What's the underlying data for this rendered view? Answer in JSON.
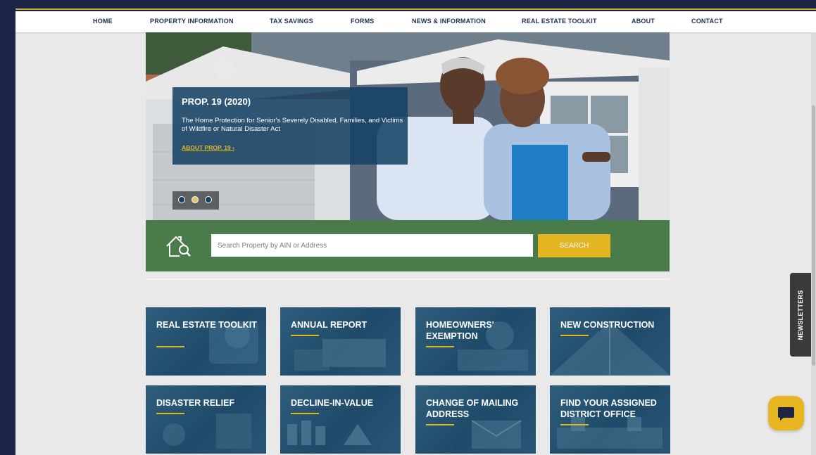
{
  "nav": {
    "items": [
      {
        "label": "HOME"
      },
      {
        "label": "PROPERTY INFORMATION"
      },
      {
        "label": "TAX SAVINGS"
      },
      {
        "label": "FORMS"
      },
      {
        "label": "NEWS & INFORMATION"
      },
      {
        "label": "REAL ESTATE TOOLKIT"
      },
      {
        "label": "ABOUT"
      },
      {
        "label": "CONTACT"
      }
    ]
  },
  "hero": {
    "title": "PROP. 19 (2020)",
    "description": "The Home Protection for Senior's Severely Disabled, Families, and Victims of Wildfire or Natural Disaster Act",
    "link": "ABOUT PROP. 19 ›",
    "slides": 3,
    "active_slide": 2
  },
  "search": {
    "placeholder": "Search Property by AIN or Address",
    "value": "",
    "button": "SEARCH",
    "icon": "house-search-icon"
  },
  "tiles": [
    {
      "label": "REAL ESTATE TOOLKIT"
    },
    {
      "label": "ANNUAL REPORT"
    },
    {
      "label": "HOMEOWNERS' EXEMPTION"
    },
    {
      "label": "NEW CONSTRUCTION"
    },
    {
      "label": "DISASTER RELIEF"
    },
    {
      "label": "DECLINE-IN-VALUE"
    },
    {
      "label": "CHANGE OF MAILING ADDRESS"
    },
    {
      "label": "FIND YOUR ASSIGNED DISTRICT OFFICE"
    }
  ],
  "sidebar_tab": {
    "label": "NEWSLETTERS"
  },
  "chat": {
    "icon": "chat-bubble-icon"
  },
  "colors": {
    "navy": "#1d2547",
    "gold": "#e3b520",
    "green": "#4a7c4b",
    "promo_blue": "#164264",
    "nav_text": "#1f2d4d"
  }
}
